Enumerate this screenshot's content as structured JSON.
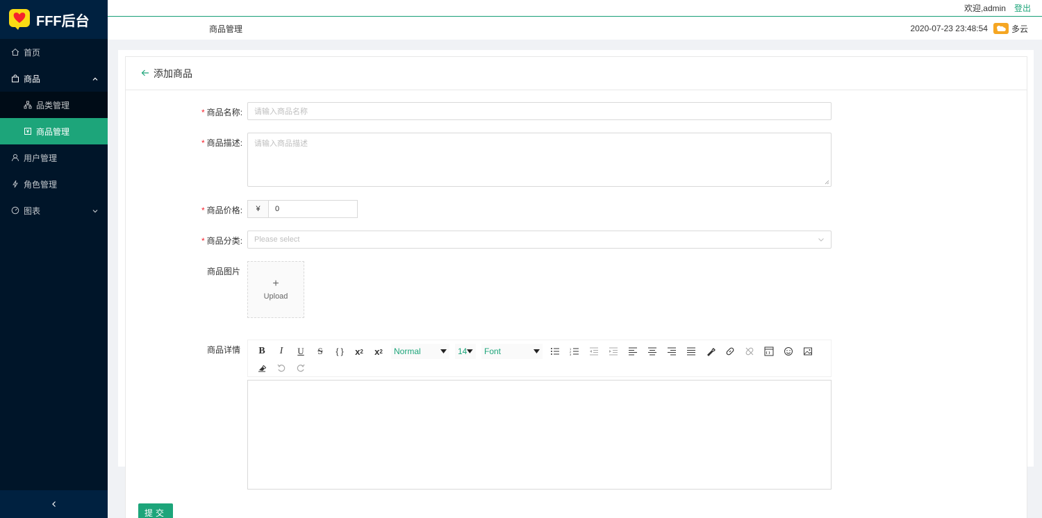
{
  "app": {
    "logo_text": "FFF后台"
  },
  "sidebar": {
    "items": [
      {
        "label": "首页",
        "icon": "home-icon"
      },
      {
        "label": "商品",
        "icon": "shopping-icon",
        "expanded": true,
        "children": [
          {
            "label": "品类管理",
            "icon": "apartment-icon"
          },
          {
            "label": "商品管理",
            "icon": "product-icon",
            "active": true
          }
        ]
      },
      {
        "label": "用户管理",
        "icon": "user-icon"
      },
      {
        "label": "角色管理",
        "icon": "thunderbolt-icon"
      },
      {
        "label": "图表",
        "icon": "dashboard-icon"
      }
    ],
    "collapse_icon": "chevron-left-icon"
  },
  "header": {
    "welcome": "欢迎,admin",
    "logout": "登出",
    "breadcrumb": "商品管理",
    "datetime": "2020-07-23 23:48:54",
    "weather": "多云",
    "weather_icon": "cloudy-icon"
  },
  "form": {
    "title": "添加商品",
    "name": {
      "label": "商品名称",
      "placeholder": "请输入商品名称"
    },
    "desc": {
      "label": "商品描述",
      "placeholder": "请输入商品描述"
    },
    "price": {
      "label": "商品价格",
      "prefix": "¥",
      "value": "0"
    },
    "category": {
      "label": "商品分类",
      "placeholder": "Please select"
    },
    "image": {
      "label": "商品图片",
      "upload_text": "Upload"
    },
    "detail": {
      "label": "商品详情",
      "header_select": "Normal",
      "size_select": "14",
      "font_select": "Font"
    },
    "submit": "提交"
  },
  "colors": {
    "primary": "#1da57a",
    "sidebar_bg": "#001529",
    "required": "#f5222d"
  }
}
